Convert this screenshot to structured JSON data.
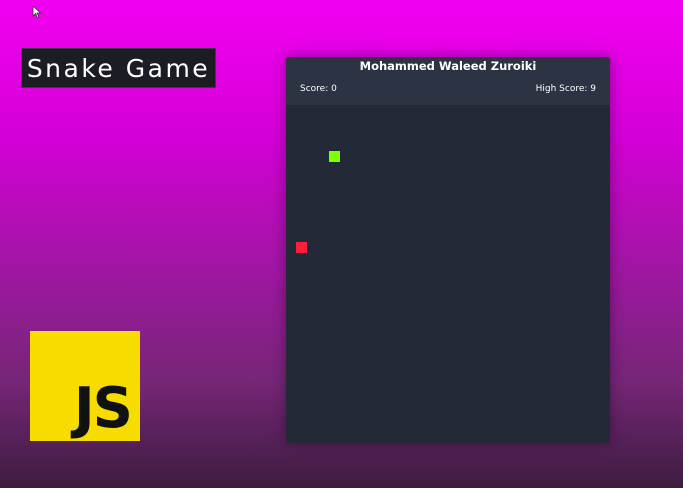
{
  "page": {
    "title": "Snake Game",
    "logo_text": "JS"
  },
  "game": {
    "player_name": "Mohammed Waleed Zuroiki",
    "score_text": "Score: 0",
    "high_score_text": "High Score: 9",
    "snake_color": "#7cff00",
    "food_color": "#ff1f3d"
  },
  "colors": {
    "background_top": "#f200f2",
    "background_bottom": "#3d1d3f",
    "logo_bg": "#f7dc00",
    "board_bg": "#232936",
    "header_bg": "#2c3444"
  },
  "icons": {
    "cursor": "mouse-pointer-icon"
  }
}
